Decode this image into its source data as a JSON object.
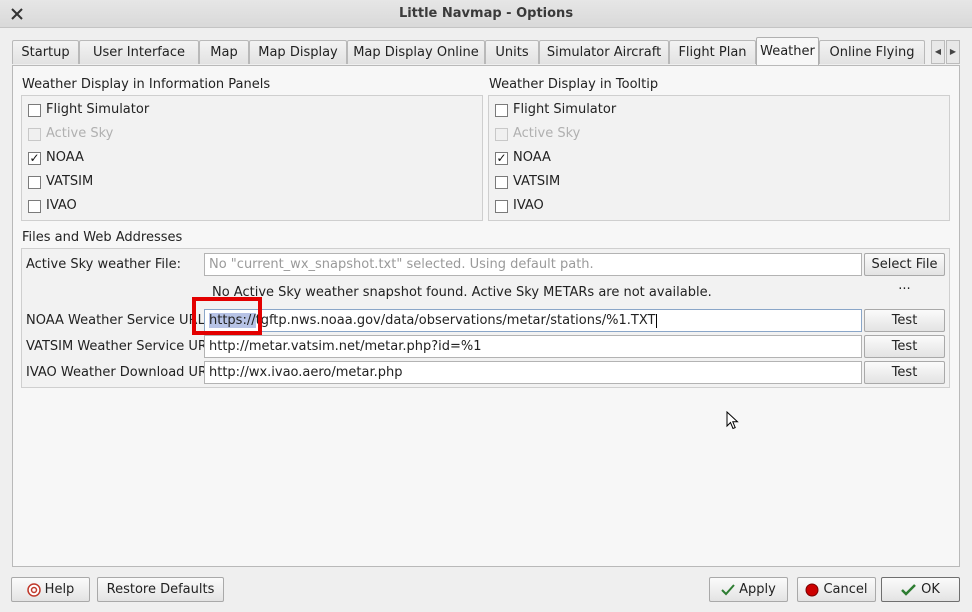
{
  "window": {
    "title": "Little Navmap - Options"
  },
  "tabs": [
    {
      "label": "Startup"
    },
    {
      "label": "User Interface"
    },
    {
      "label": "Map"
    },
    {
      "label": "Map Display"
    },
    {
      "label": "Map Display Online"
    },
    {
      "label": "Units"
    },
    {
      "label": "Simulator Aircraft"
    },
    {
      "label": "Flight Plan"
    },
    {
      "label": "Weather",
      "active": true
    },
    {
      "label": "Online Flying"
    }
  ],
  "info_panels": {
    "title": "Weather Display in Information Panels",
    "items": [
      {
        "label": "Flight Simulator",
        "checked": false,
        "disabled": false
      },
      {
        "label": "Active Sky",
        "checked": false,
        "disabled": true
      },
      {
        "label": "NOAA",
        "checked": true,
        "disabled": false
      },
      {
        "label": "VATSIM",
        "checked": false,
        "disabled": false
      },
      {
        "label": "IVAO",
        "checked": false,
        "disabled": false
      }
    ]
  },
  "tooltip": {
    "title": "Weather Display in Tooltip",
    "items": [
      {
        "label": "Flight Simulator",
        "checked": false,
        "disabled": false
      },
      {
        "label": "Active Sky",
        "checked": false,
        "disabled": true
      },
      {
        "label": "NOAA",
        "checked": true,
        "disabled": false
      },
      {
        "label": "VATSIM",
        "checked": false,
        "disabled": false
      },
      {
        "label": "IVAO",
        "checked": false,
        "disabled": false
      }
    ]
  },
  "files": {
    "title": "Files and Web Addresses",
    "activesky": {
      "label": "Active Sky weather File:",
      "placeholder": "No \"current_wx_snapshot.txt\" selected. Using default path.",
      "button": "Select File ..."
    },
    "status": "No Active Sky weather snapshot found. Active Sky METARs are not available.",
    "noaa": {
      "label": "NOAA Weather Service URL:",
      "value_selected": "https://",
      "value_rest": "tgftp.nws.noaa.gov/data/observations/metar/stations/%1.TXT",
      "button": "Test"
    },
    "vatsim": {
      "label": "VATSIM Weather Service URL:",
      "value": "http://metar.vatsim.net/metar.php?id=%1",
      "button": "Test"
    },
    "ivao": {
      "label": "IVAO Weather Download URL:",
      "value": "http://wx.ivao.aero/metar.php",
      "button": "Test"
    }
  },
  "buttons": {
    "help": "Help",
    "restore": "Restore Defaults",
    "apply": "Apply",
    "cancel": "Cancel",
    "ok": "OK"
  },
  "colors": {
    "highlight_box": "#e30000",
    "selection": "#b7c3e6",
    "cancel_icon": "#cc0000",
    "apply_icon": "#2e7d32"
  }
}
